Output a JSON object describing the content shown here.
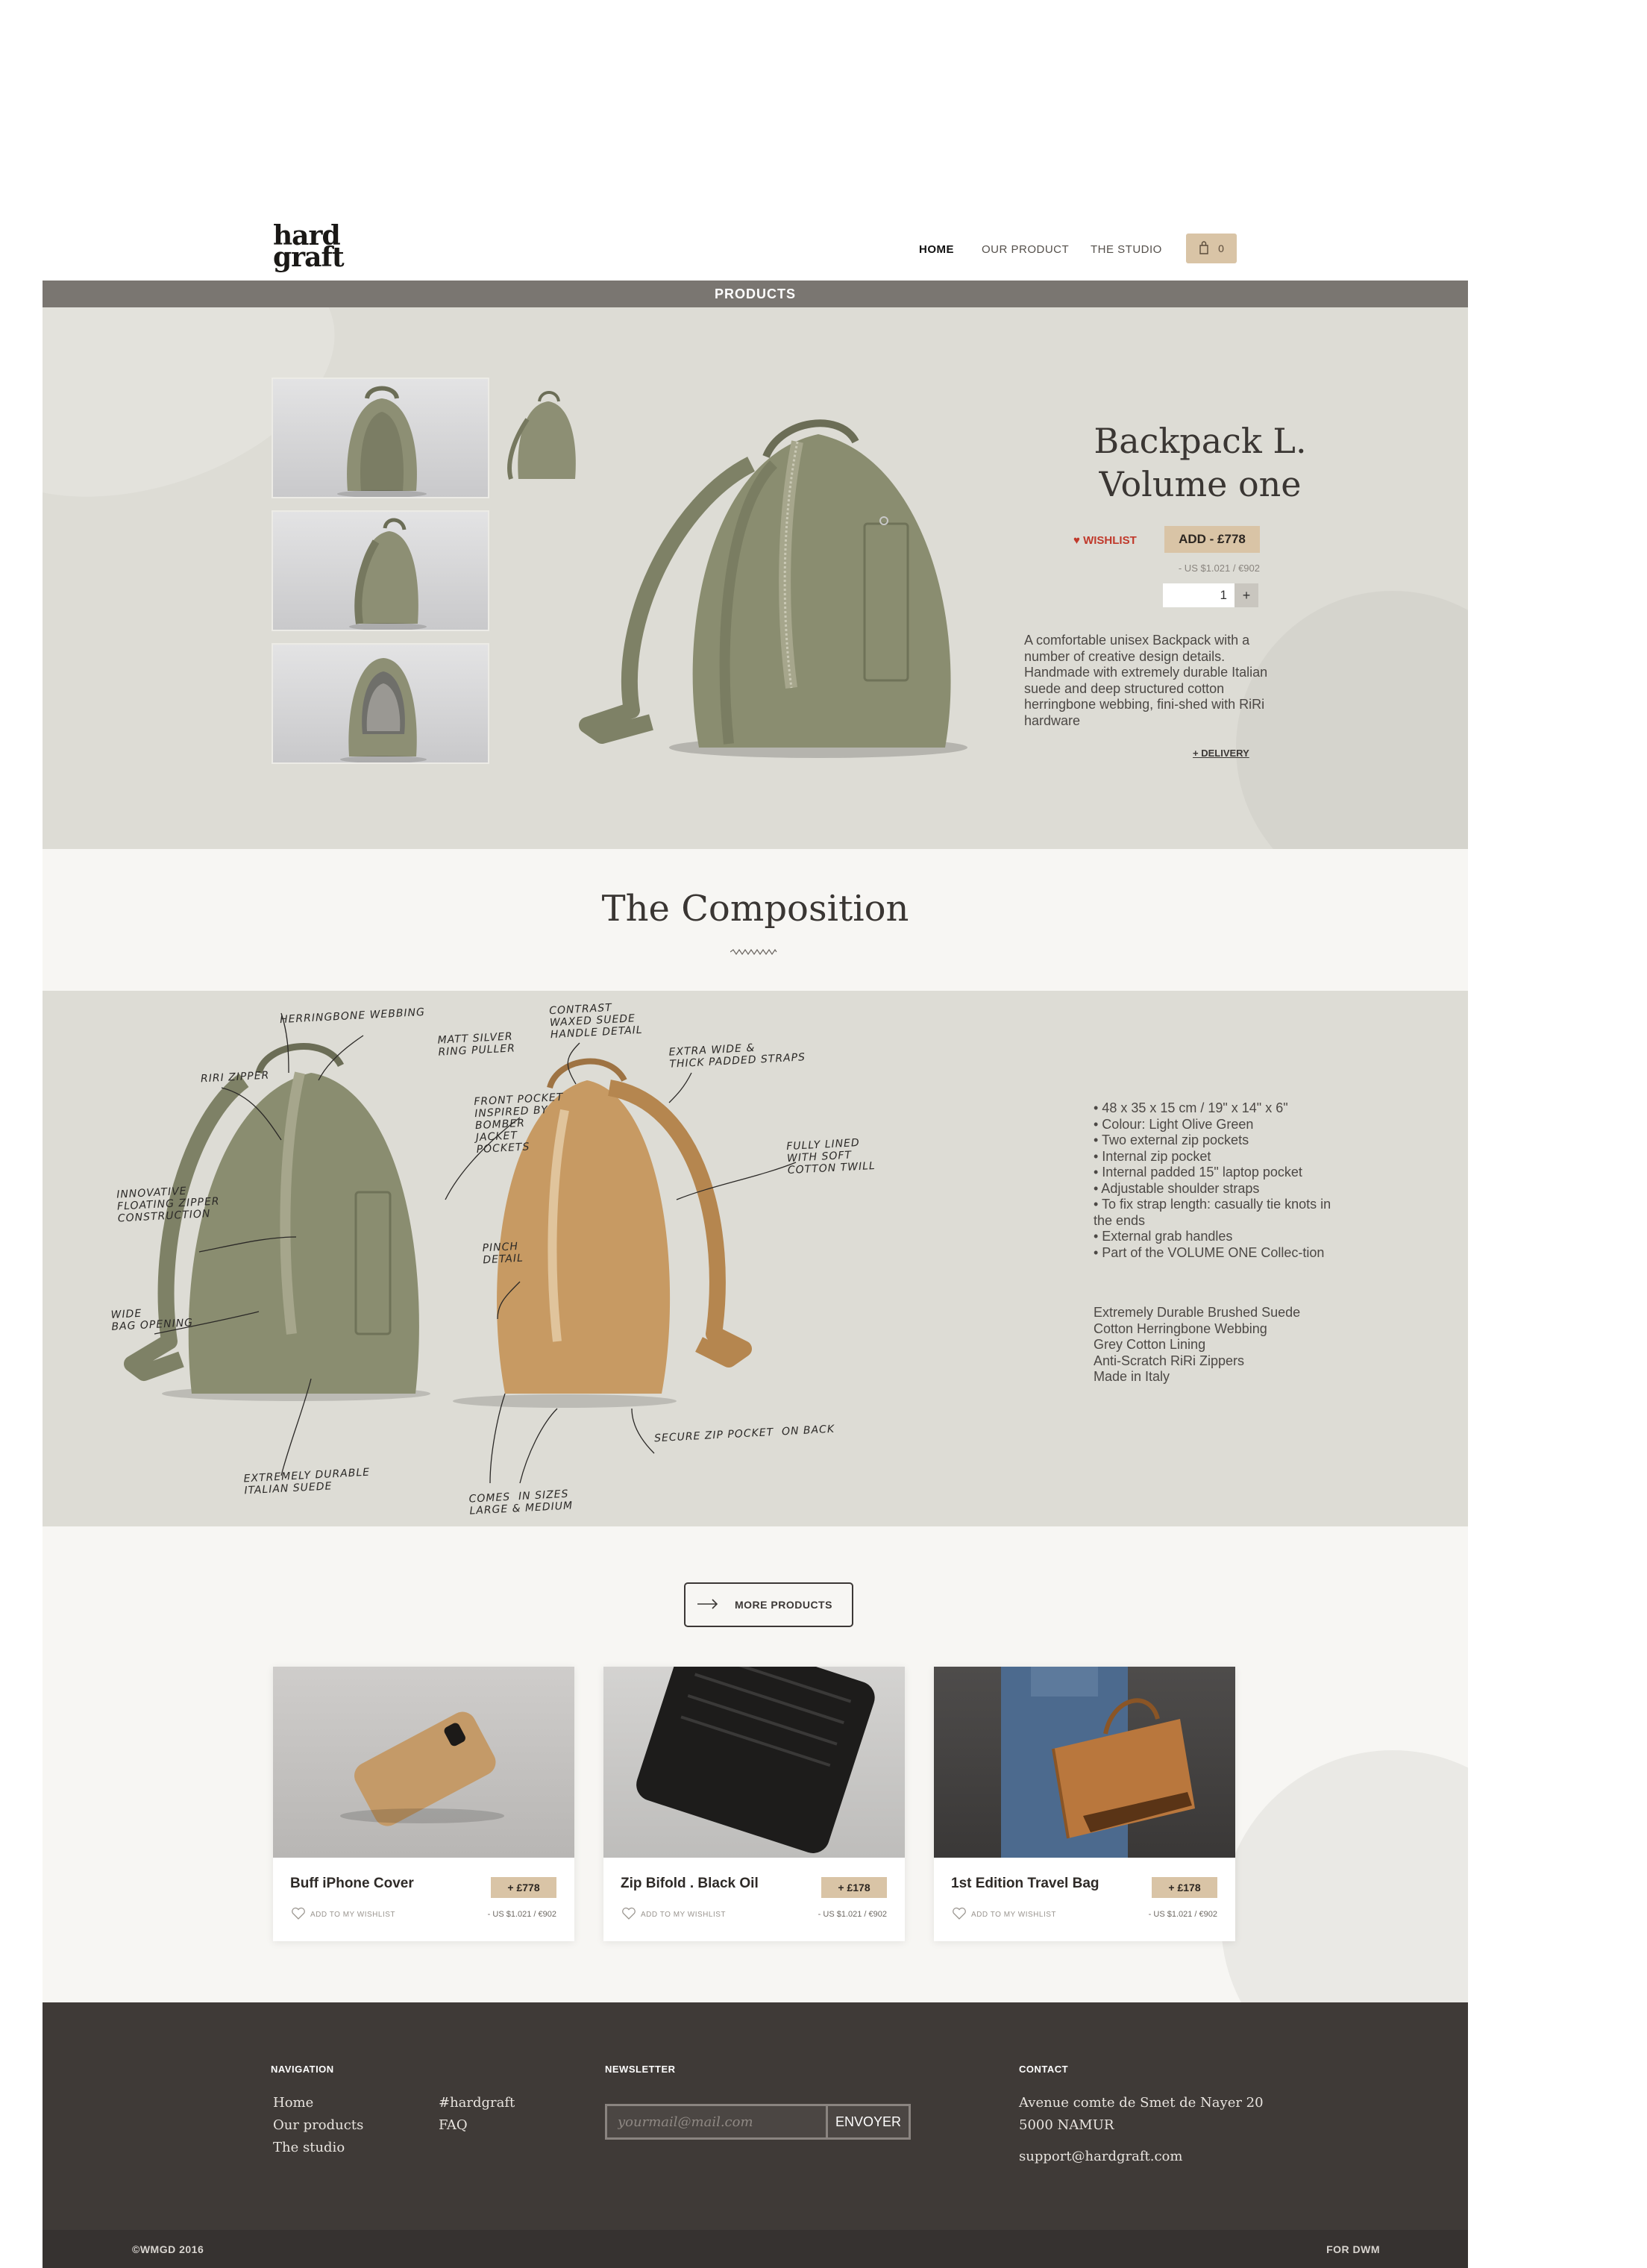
{
  "header": {
    "logo_line1": "hard",
    "logo_line2": "graft",
    "nav": [
      {
        "label": "HOME"
      },
      {
        "label": "OUR PRODUCT"
      },
      {
        "label": "THE STUDIO"
      }
    ],
    "cart_count": "0",
    "section_bar": "PRODUCTS"
  },
  "product": {
    "title_line1": "Backpack L.",
    "title_line2": "Volume one",
    "wishlist_label": "WISHLIST",
    "add_label": "ADD - £778",
    "usd_price": "- US $1.021 / €902",
    "quantity": "1",
    "quantity_plus": "+",
    "description": "A comfortable unisex Backpack with a number of creative design details. Handmade with extremely durable Italian suede and deep structured cotton herringbone webbing, fini-shed with RiRi hardware",
    "delivery_label": "+ DELIVERY"
  },
  "composition": {
    "title": "The Composition",
    "annotations": [
      "HERRINGBONE WEBBING",
      "MATT SILVER\nRING PULLER",
      "CONTRAST\nWAXED SUEDE\nHANDLE DETAIL",
      "EXTRA WIDE &\nTHICK PADDED STRAPS",
      "RIRI ZIPPER",
      "FRONT POCKET\nINSPIRED BY\nBOMBER\nJACKET\nPOCKETS",
      "FULLY LINED\nWITH SOFT\nCOTTON TWILL",
      "INNOVATIVE\nFLOATING ZIPPER\nCONSTRUCTION",
      "PINCH\nDETAIL",
      "WIDE\nBAG OPENING",
      "SECURE ZIP POCKET  ON BACK",
      "EXTREMELY DURABLE\nITALIAN SUEDE",
      "COMES  IN SIZES\nLARGE & MEDIUM"
    ],
    "specs": [
      "• 48 x 35 x 15 cm / 19\" x 14\" x 6\"",
      "• Colour: Light Olive Green",
      "• Two external zip pockets",
      "• Internal zip pocket",
      "• Internal padded 15\" laptop pocket",
      "• Adjustable shoulder straps",
      "• To fix strap length: casually tie knots in the ends",
      "• External grab handles",
      "• Part of the VOLUME ONE Collec-tion"
    ],
    "materials": [
      "Extremely Durable Brushed Suede",
      "Cotton Herringbone Webbing",
      "Grey Cotton Lining",
      "Anti-Scratch RiRi Zippers",
      "Made in Italy"
    ]
  },
  "more_products": {
    "button_label": "MORE PRODUCTS",
    "cards": [
      {
        "name": "Buff iPhone Cover",
        "price": "+ £778",
        "wishlist": "ADD TO MY WISHLIST",
        "usd": "- US $1.021 / €902"
      },
      {
        "name": "Zip Bifold . Black Oil",
        "price": "+ £178",
        "wishlist": "ADD TO MY WISHLIST",
        "usd": "- US $1.021 / €902"
      },
      {
        "name": "1st Edition Travel Bag",
        "price": "+ £178",
        "wishlist": "ADD TO MY WISHLIST",
        "usd": "- US $1.021 / €902"
      }
    ]
  },
  "footer": {
    "navigation_heading": "NAVIGATION",
    "nav_col1": [
      "Home",
      "Our products",
      "The studio"
    ],
    "nav_col2": [
      "#hardgraft",
      "FAQ"
    ],
    "newsletter_heading": "NEWSLETTER",
    "newsletter_placeholder": "yourmail@mail.com",
    "newsletter_button": "ENVOYER",
    "contact_heading": "CONTACT",
    "address_line1": "Avenue comte de Smet de Nayer 20",
    "address_line2": "5000 NAMUR",
    "email": "support@hardgraft.com",
    "copyright": "©WMGD 2016",
    "credit": "FOR DWM"
  },
  "colors": {
    "accent_tan": "#d9c4a6",
    "hero_bg": "#dddcd5",
    "footer_bg": "#3f3a37",
    "wishlist_red": "#c0392b"
  }
}
